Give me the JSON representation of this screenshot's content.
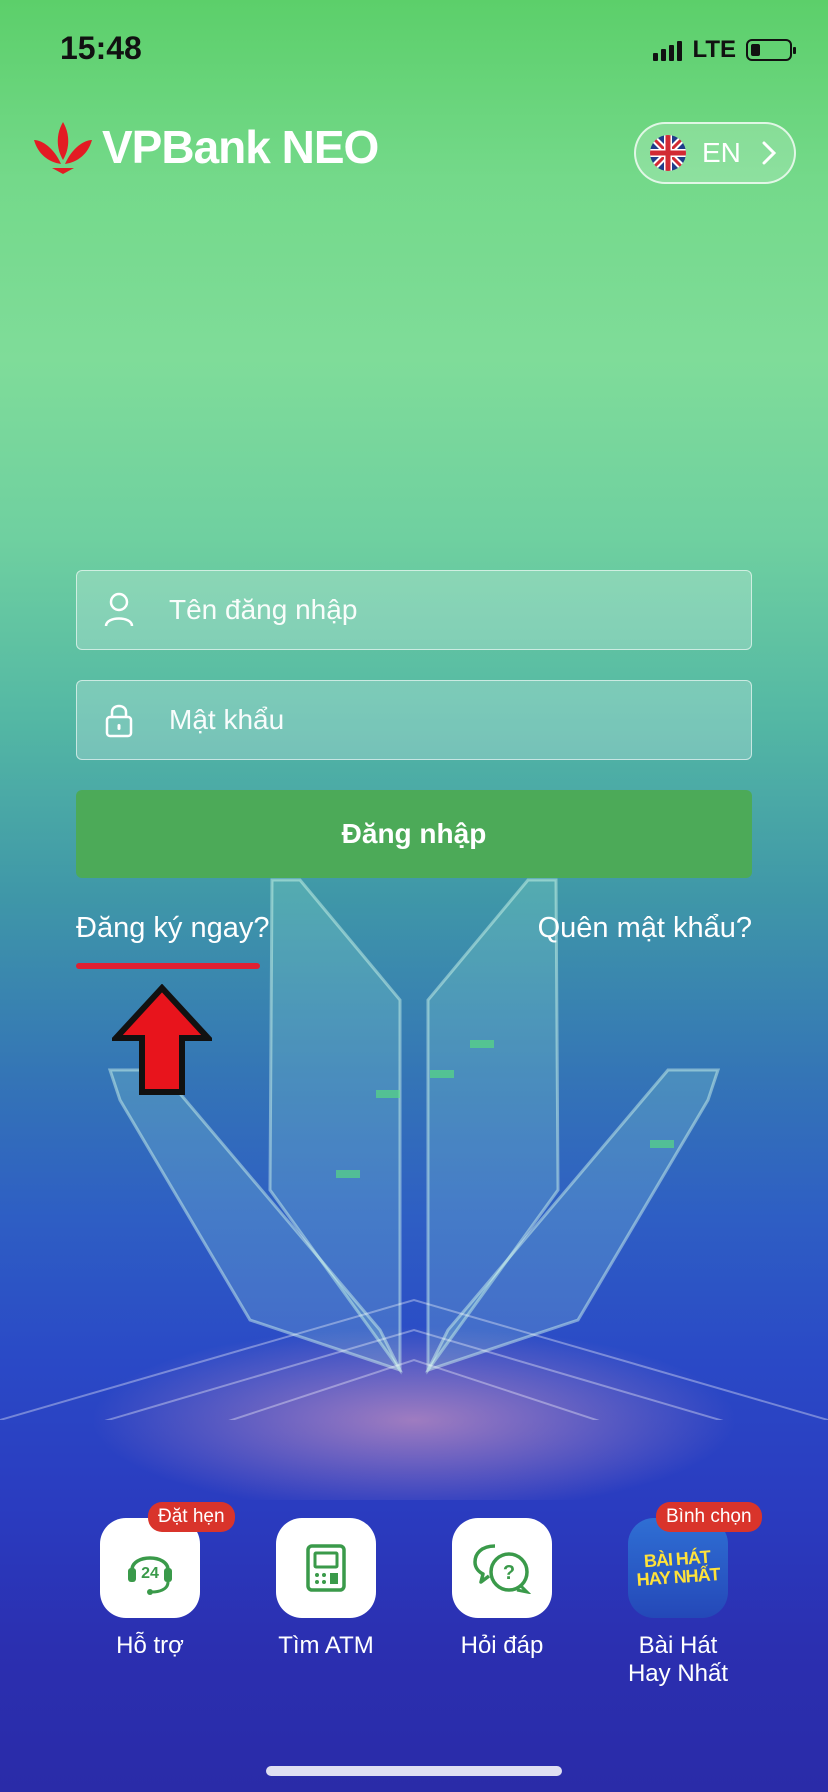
{
  "status_bar": {
    "time": "15:48",
    "network": "LTE",
    "battery_level": 0.25
  },
  "header": {
    "logo_text": "VPBank NEO",
    "language": {
      "label": "EN",
      "flag_icon": "uk-flag-icon"
    }
  },
  "login_form": {
    "username_placeholder": "Tên đăng nhập",
    "password_placeholder": "Mật khẩu",
    "login_button": "Đăng nhập",
    "register_link": "Đăng ký ngay?",
    "forgot_link": "Quên mật khẩu?"
  },
  "annotation": {
    "arrow_color": "#e8141c",
    "underline_color": "#e02032"
  },
  "quick_actions": [
    {
      "label": "Hỗ trợ",
      "badge": "Đặt hẹn",
      "icon": "headset-24-icon"
    },
    {
      "label": "Tìm ATM",
      "badge": "",
      "icon": "atm-icon"
    },
    {
      "label": "Hỏi đáp",
      "badge": "",
      "icon": "question-chat-icon"
    },
    {
      "label_line1": "Bài Hát",
      "label_line2": "Hay Nhất",
      "badge": "Bình chọn",
      "icon": "song-logo-icon",
      "tile_text_1": "BÀI HÁT",
      "tile_text_2": "HAY NHẤT"
    }
  ],
  "colors": {
    "brand_green": "#4caa58",
    "badge_red": "#d9342b",
    "icon_green": "#3a9a4a"
  }
}
